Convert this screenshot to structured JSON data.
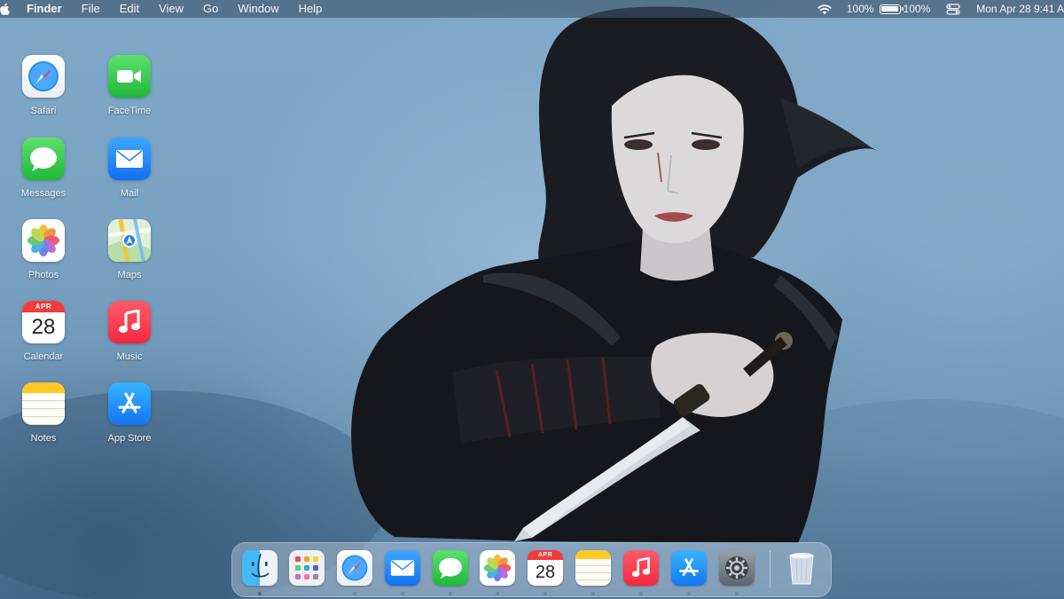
{
  "menubar": {
    "apple_icon": "apple-logo-icon",
    "app_name": "Finder",
    "menus": [
      "File",
      "Edit",
      "View",
      "Go",
      "Window",
      "Help"
    ],
    "wifi_icon": "wifi-icon",
    "battery_text": "100%",
    "battery_percent": "100%",
    "battery_level": 1.0,
    "control_center_icon": "control-center-icon",
    "clock": "Mon Apr 28  9:41 A"
  },
  "desktop": {
    "wallpaper": "misty blue portrait of a dark-haired warrior holding a dagger",
    "icons": [
      {
        "label": "Safari",
        "icon": "safari-icon"
      },
      {
        "label": "FaceTime",
        "icon": "facetime-icon"
      },
      {
        "label": "Messages",
        "icon": "messages-icon"
      },
      {
        "label": "Mail",
        "icon": "mail-icon"
      },
      {
        "label": "Photos",
        "icon": "photos-icon"
      },
      {
        "label": "Maps",
        "icon": "maps-icon"
      },
      {
        "label": "Calendar",
        "icon": "calendar-icon",
        "month": "APR",
        "day": "28"
      },
      {
        "label": "Music",
        "icon": "music-icon"
      },
      {
        "label": "Notes",
        "icon": "notes-icon"
      },
      {
        "label": "App Store",
        "icon": "app-store-icon"
      }
    ]
  },
  "dock": {
    "items": [
      {
        "app": "Finder",
        "icon": "finder-icon",
        "running": true
      },
      {
        "app": "Launchpad",
        "icon": "launchpad-icon",
        "running": false
      },
      {
        "app": "Safari",
        "icon": "safari-icon",
        "running": true
      },
      {
        "app": "Mail",
        "icon": "mail-icon",
        "running": true
      },
      {
        "app": "Messages",
        "icon": "messages-icon",
        "running": true
      },
      {
        "app": "Photos",
        "icon": "photos-icon",
        "running": true
      },
      {
        "app": "Calendar",
        "icon": "calendar-icon",
        "running": true,
        "month": "APR",
        "day": "28"
      },
      {
        "app": "Notes",
        "icon": "notes-icon",
        "running": true
      },
      {
        "app": "Music",
        "icon": "music-icon",
        "running": true
      },
      {
        "app": "App Store",
        "icon": "app-store-icon",
        "running": true
      },
      {
        "app": "System Settings",
        "icon": "settings-gear-icon",
        "running": true
      }
    ],
    "trash": {
      "icon": "trash-icon"
    }
  },
  "colors": {
    "menubar_bg": "#3c5268",
    "accent_green": "#1fb83a",
    "accent_blue": "#1170f0",
    "accent_red": "#f3283f",
    "calendar_red": "#f23b3b"
  }
}
